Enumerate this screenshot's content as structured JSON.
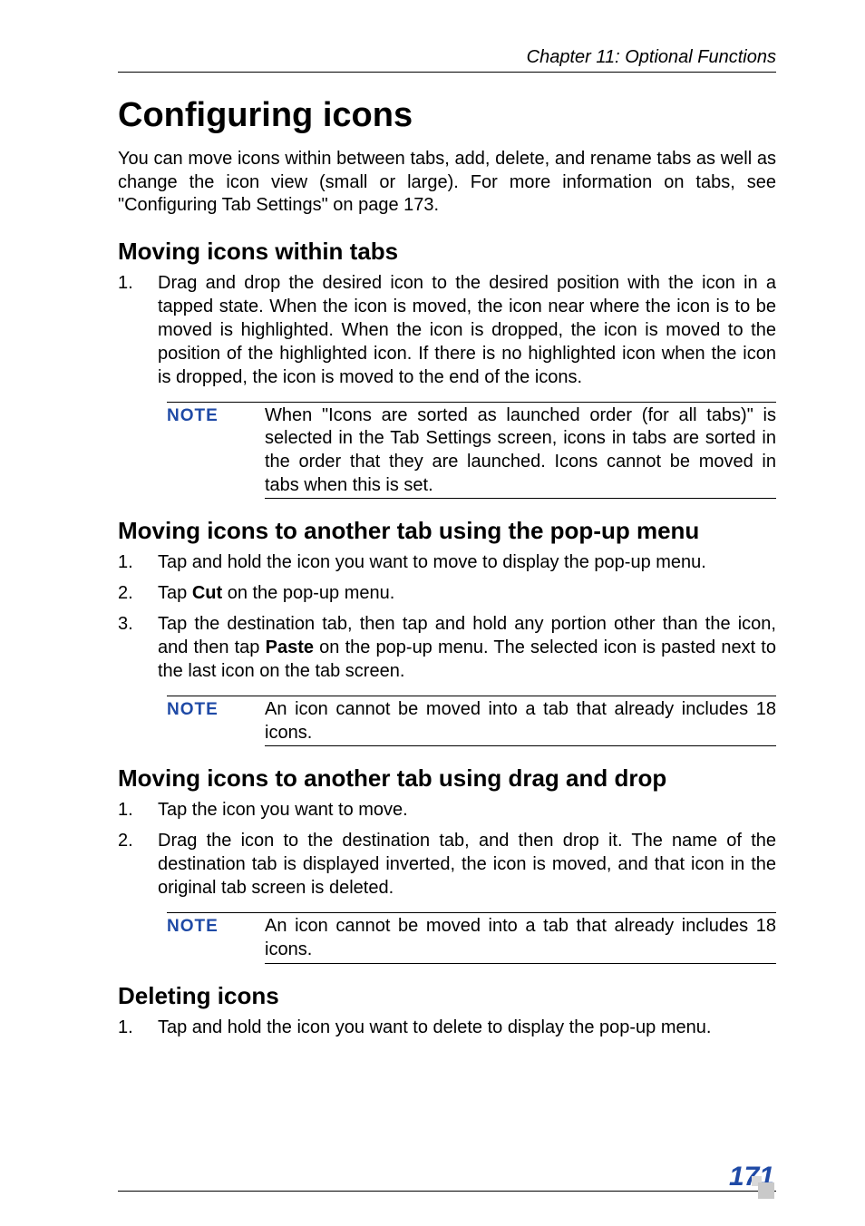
{
  "running_header": "Chapter 11: Optional Functions",
  "h1": "Configuring icons",
  "intro": "You can move icons within between tabs, add, delete, and rename tabs as well as change the icon view (small or large). For more information on tabs, see \"Configuring Tab Settings\" on page 173.",
  "section1": {
    "title": "Moving icons within tabs",
    "items": {
      "n1": "1.",
      "t1": "Drag and drop the desired icon to the desired position with the icon in a tapped state. When the icon is moved, the icon near where the icon is to be moved is highlighted. When the icon is dropped, the icon is moved to the position of the highlighted icon. If there is no highlighted icon when the icon is dropped, the icon is moved to the end of the icons."
    },
    "note": "When \"Icons are sorted as launched order (for all tabs)\" is selected in the Tab Settings screen, icons in tabs are sorted in the order that they are launched. Icons cannot be moved in tabs when this is set."
  },
  "section2": {
    "title": "Moving icons to another tab using the pop-up menu",
    "items": {
      "n1": "1.",
      "t1": "Tap and hold the icon you want to move to display the pop-up menu.",
      "n2": "2.",
      "t2a": "Tap ",
      "t2bold": "Cut",
      "t2b": " on the pop-up menu.",
      "n3": "3.",
      "t3a": "Tap the destination tab, then tap and hold any portion other than the icon, and then tap ",
      "t3bold": "Paste",
      "t3b": " on the pop-up menu. The selected icon is pasted next to the last icon on the tab screen."
    },
    "note": "An icon cannot be moved into a tab that already includes 18 icons."
  },
  "section3": {
    "title": "Moving icons to another tab using drag and drop",
    "items": {
      "n1": "1.",
      "t1": "Tap the icon you want to move.",
      "n2": "2.",
      "t2": "Drag the icon to the destination tab, and then drop it. The name of the destination tab is displayed inverted, the icon is moved, and that icon in the original tab screen is deleted."
    },
    "note": "An icon cannot be moved into a tab that already includes 18 icons."
  },
  "section4": {
    "title": "Deleting icons",
    "items": {
      "n1": "1.",
      "t1": "Tap and hold the icon you want to delete to display the pop-up menu."
    }
  },
  "note_label": "NOTE",
  "page_number": "171"
}
